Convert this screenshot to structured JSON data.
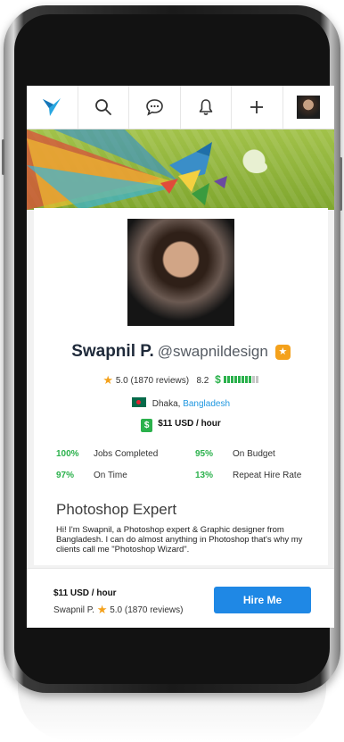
{
  "profile": {
    "name": "Swapnil P.",
    "handle": "@swapnildesign",
    "rating": "5.0",
    "reviews": "(1870 reviews)",
    "earnings_score": "8.2",
    "earnings_level": 0.8,
    "city": "Dhaka,",
    "country": "Bangladesh",
    "hourly_rate": "$11 USD / hour",
    "headline": "Photoshop Expert",
    "bio": "Hi! I'm Swapnil, a Photoshop expert & Graphic designer from Bangladesh. I can do almost anything in Photoshop that's why my clients call me \"Photoshop Wizard\"."
  },
  "stats": [
    {
      "value": "100%",
      "label": "Jobs Completed"
    },
    {
      "value": "95%",
      "label": "On Budget"
    },
    {
      "value": "97%",
      "label": "On Time"
    },
    {
      "value": "13%",
      "label": "Repeat Hire Rate"
    }
  ],
  "bottom_bar": {
    "rate": "$11 USD / hour",
    "name": "Swapnil P.",
    "rating": "5.0 (1870 reviews)",
    "hire_label": "Hire Me"
  },
  "icons": {
    "logo": "freelancer-bird-icon",
    "search": "search-icon",
    "messages": "chat-icon",
    "notifications": "bell-icon",
    "post": "plus-icon",
    "avatar": "user-avatar"
  },
  "colors": {
    "accent": "#1f88e5",
    "green": "#2bb14c",
    "star": "#f4a11b",
    "link": "#1f97e0"
  }
}
